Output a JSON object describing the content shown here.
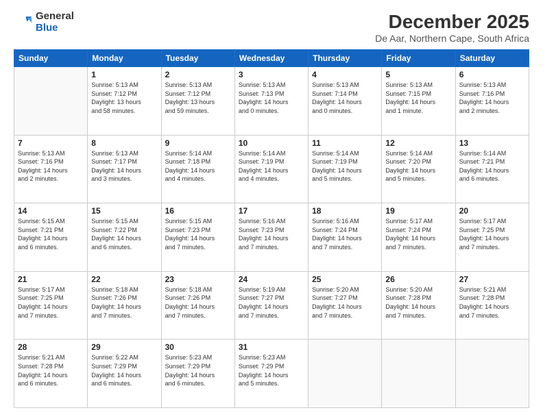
{
  "logo": {
    "general": "General",
    "blue": "Blue"
  },
  "header": {
    "title": "December 2025",
    "location": "De Aar, Northern Cape, South Africa"
  },
  "weekdays": [
    "Sunday",
    "Monday",
    "Tuesday",
    "Wednesday",
    "Thursday",
    "Friday",
    "Saturday"
  ],
  "weeks": [
    [
      {
        "day": "",
        "info": ""
      },
      {
        "day": "1",
        "info": "Sunrise: 5:13 AM\nSunset: 7:12 PM\nDaylight: 13 hours\nand 58 minutes."
      },
      {
        "day": "2",
        "info": "Sunrise: 5:13 AM\nSunset: 7:12 PM\nDaylight: 13 hours\nand 59 minutes."
      },
      {
        "day": "3",
        "info": "Sunrise: 5:13 AM\nSunset: 7:13 PM\nDaylight: 14 hours\nand 0 minutes."
      },
      {
        "day": "4",
        "info": "Sunrise: 5:13 AM\nSunset: 7:14 PM\nDaylight: 14 hours\nand 0 minutes."
      },
      {
        "day": "5",
        "info": "Sunrise: 5:13 AM\nSunset: 7:15 PM\nDaylight: 14 hours\nand 1 minute."
      },
      {
        "day": "6",
        "info": "Sunrise: 5:13 AM\nSunset: 7:16 PM\nDaylight: 14 hours\nand 2 minutes."
      }
    ],
    [
      {
        "day": "7",
        "info": "Sunrise: 5:13 AM\nSunset: 7:16 PM\nDaylight: 14 hours\nand 2 minutes."
      },
      {
        "day": "8",
        "info": "Sunrise: 5:13 AM\nSunset: 7:17 PM\nDaylight: 14 hours\nand 3 minutes."
      },
      {
        "day": "9",
        "info": "Sunrise: 5:14 AM\nSunset: 7:18 PM\nDaylight: 14 hours\nand 4 minutes."
      },
      {
        "day": "10",
        "info": "Sunrise: 5:14 AM\nSunset: 7:19 PM\nDaylight: 14 hours\nand 4 minutes."
      },
      {
        "day": "11",
        "info": "Sunrise: 5:14 AM\nSunset: 7:19 PM\nDaylight: 14 hours\nand 5 minutes."
      },
      {
        "day": "12",
        "info": "Sunrise: 5:14 AM\nSunset: 7:20 PM\nDaylight: 14 hours\nand 5 minutes."
      },
      {
        "day": "13",
        "info": "Sunrise: 5:14 AM\nSunset: 7:21 PM\nDaylight: 14 hours\nand 6 minutes."
      }
    ],
    [
      {
        "day": "14",
        "info": "Sunrise: 5:15 AM\nSunset: 7:21 PM\nDaylight: 14 hours\nand 6 minutes."
      },
      {
        "day": "15",
        "info": "Sunrise: 5:15 AM\nSunset: 7:22 PM\nDaylight: 14 hours\nand 6 minutes."
      },
      {
        "day": "16",
        "info": "Sunrise: 5:15 AM\nSunset: 7:23 PM\nDaylight: 14 hours\nand 7 minutes."
      },
      {
        "day": "17",
        "info": "Sunrise: 5:16 AM\nSunset: 7:23 PM\nDaylight: 14 hours\nand 7 minutes."
      },
      {
        "day": "18",
        "info": "Sunrise: 5:16 AM\nSunset: 7:24 PM\nDaylight: 14 hours\nand 7 minutes."
      },
      {
        "day": "19",
        "info": "Sunrise: 5:17 AM\nSunset: 7:24 PM\nDaylight: 14 hours\nand 7 minutes."
      },
      {
        "day": "20",
        "info": "Sunrise: 5:17 AM\nSunset: 7:25 PM\nDaylight: 14 hours\nand 7 minutes."
      }
    ],
    [
      {
        "day": "21",
        "info": "Sunrise: 5:17 AM\nSunset: 7:25 PM\nDaylight: 14 hours\nand 7 minutes."
      },
      {
        "day": "22",
        "info": "Sunrise: 5:18 AM\nSunset: 7:26 PM\nDaylight: 14 hours\nand 7 minutes."
      },
      {
        "day": "23",
        "info": "Sunrise: 5:18 AM\nSunset: 7:26 PM\nDaylight: 14 hours\nand 7 minutes."
      },
      {
        "day": "24",
        "info": "Sunrise: 5:19 AM\nSunset: 7:27 PM\nDaylight: 14 hours\nand 7 minutes."
      },
      {
        "day": "25",
        "info": "Sunrise: 5:20 AM\nSunset: 7:27 PM\nDaylight: 14 hours\nand 7 minutes."
      },
      {
        "day": "26",
        "info": "Sunrise: 5:20 AM\nSunset: 7:28 PM\nDaylight: 14 hours\nand 7 minutes."
      },
      {
        "day": "27",
        "info": "Sunrise: 5:21 AM\nSunset: 7:28 PM\nDaylight: 14 hours\nand 7 minutes."
      }
    ],
    [
      {
        "day": "28",
        "info": "Sunrise: 5:21 AM\nSunset: 7:28 PM\nDaylight: 14 hours\nand 6 minutes."
      },
      {
        "day": "29",
        "info": "Sunrise: 5:22 AM\nSunset: 7:29 PM\nDaylight: 14 hours\nand 6 minutes."
      },
      {
        "day": "30",
        "info": "Sunrise: 5:23 AM\nSunset: 7:29 PM\nDaylight: 14 hours\nand 6 minutes."
      },
      {
        "day": "31",
        "info": "Sunrise: 5:23 AM\nSunset: 7:29 PM\nDaylight: 14 hours\nand 5 minutes."
      },
      {
        "day": "",
        "info": ""
      },
      {
        "day": "",
        "info": ""
      },
      {
        "day": "",
        "info": ""
      }
    ]
  ]
}
